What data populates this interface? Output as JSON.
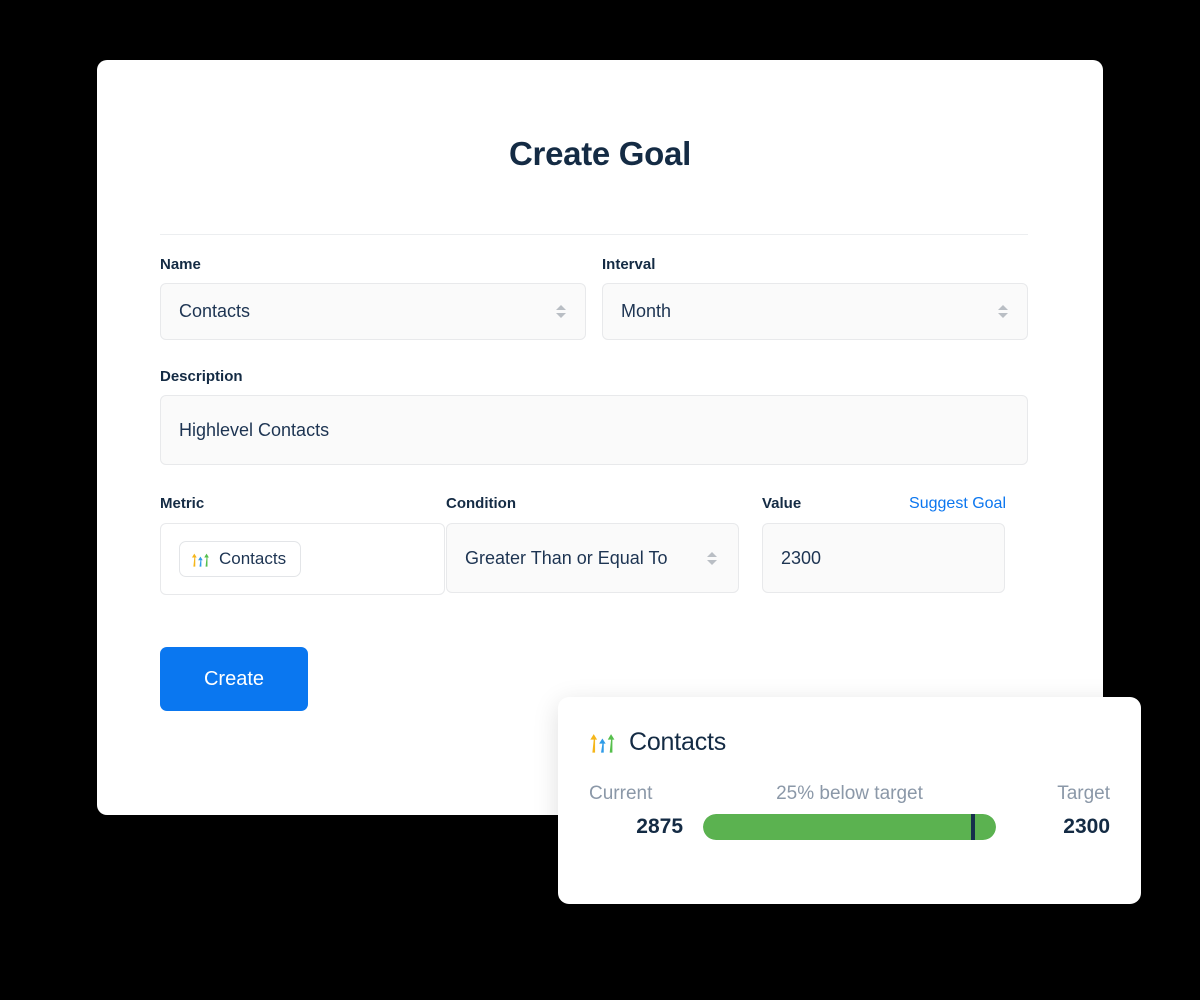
{
  "page": {
    "background_color": "#000000"
  },
  "panel": {
    "title": "Create Goal",
    "background_color": "#ffffff"
  },
  "form": {
    "name": {
      "label": "Name",
      "value": "Contacts",
      "icon": "selector-chevrons-icon"
    },
    "interval": {
      "label": "Interval",
      "value": "Month",
      "icon": "selector-chevrons-icon"
    },
    "description": {
      "label": "Description",
      "value": "Highlevel Contacts"
    },
    "metric": {
      "label": "Metric",
      "chip_label": "Contacts",
      "chip_icon": "growth-arrows-icon"
    },
    "condition": {
      "label": "Condition",
      "value": "Greater Than or Equal To",
      "icon": "selector-chevrons-icon"
    },
    "value": {
      "label": "Value",
      "value": "2300",
      "suggest_link": "Suggest Goal",
      "suggest_link_color": "#0b76ef"
    },
    "submit": {
      "label": "Create",
      "color": "#0a77f0"
    }
  },
  "goal_card": {
    "icon": "growth-arrows-icon",
    "title": "Contacts",
    "current_label": "Current",
    "current_value": "2875",
    "status_text": "25% below target",
    "target_label": "Target",
    "target_value": "2300",
    "progress": {
      "fill_percent": 100,
      "marker_percent": 92,
      "fill_color": "#5bb250",
      "marker_color": "#16304c"
    }
  },
  "chart_data": {
    "type": "bar",
    "title": "Contacts",
    "categories": [
      "Current",
      "Target"
    ],
    "values": [
      2875,
      2300
    ],
    "annotations": [
      "25% below target"
    ],
    "xlabel": "",
    "ylabel": "",
    "ylim": [
      0,
      3125
    ]
  }
}
